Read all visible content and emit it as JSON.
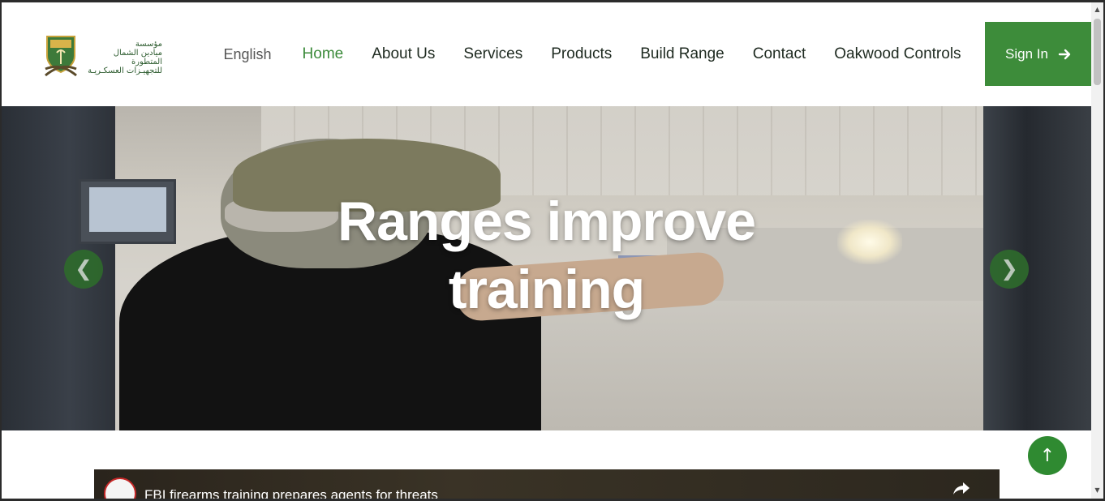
{
  "brand": {
    "logo_icon": "shield-crossed-swords-icon",
    "name_line1": "مؤسسة",
    "name_line2": "ميادين الشمال المتطورة",
    "name_line3": "للتجهيـزات العسكـريـة"
  },
  "nav": {
    "language": "English",
    "items": [
      {
        "label": "Home",
        "active": true
      },
      {
        "label": "About Us"
      },
      {
        "label": "Services"
      },
      {
        "label": "Products"
      },
      {
        "label": "Build Range"
      },
      {
        "label": "Contact"
      },
      {
        "label": "Oakwood Controls"
      }
    ]
  },
  "signin": {
    "label": "Sign In",
    "icon": "arrow-right-icon"
  },
  "hero": {
    "title_line1": "Ranges improve",
    "title_line2": "training",
    "prev_icon": "chevron-left-icon",
    "next_icon": "chevron-right-icon",
    "prev_glyph": "❮",
    "next_glyph": "❯"
  },
  "video": {
    "title": "FBI firearms training prepares agents for threats",
    "share_icon": "share-icon"
  },
  "back_to_top": {
    "icon": "arrow-up-icon",
    "glyph": "↑"
  },
  "colors": {
    "accent": "#3d8c3a",
    "active_nav": "#3b8a3a",
    "carousel_button": "#2e6b2c"
  }
}
